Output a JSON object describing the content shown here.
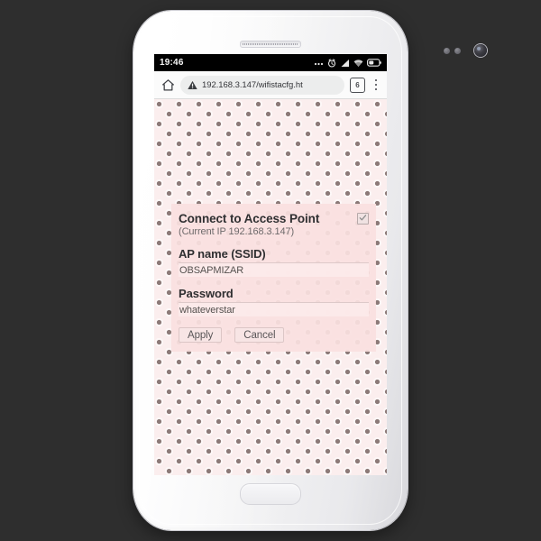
{
  "device": {
    "name": "white-smartphone",
    "earpiece": "speaker-grille",
    "home_button": "home-button"
  },
  "status_bar": {
    "clock": "19:46",
    "icons": [
      "more-dots-icon",
      "alarm-icon",
      "signal-bars-icon",
      "wifi-icon",
      "battery-icon"
    ]
  },
  "browser": {
    "home_icon": "home-icon",
    "security_icon": "warning-triangle-icon",
    "url": "192.168.3.147/wifistacfg.ht",
    "tab_count": "6",
    "menu_icon": "overflow-menu-icon"
  },
  "page": {
    "background": "pink-flower-wallpaper",
    "colors": {
      "wallpaper_base": "#fbeeee",
      "petal_light": "#f6d2d4",
      "petal_dark": "#e59aa0",
      "flower_center": "#8c7a78",
      "panel_bg": "#fae0e0",
      "input_bg": "#fceaea",
      "text_primary": "#2f2f31",
      "text_secondary": "#6e6a6b"
    }
  },
  "config_panel": {
    "title": "Connect to Access Point",
    "enable_checkbox": {
      "label": "connect-enabled",
      "checked": true
    },
    "subtitle": "(Current IP 192.168.3.147)",
    "fields": [
      {
        "label": "AP name (SSID)",
        "value": "OBSAPMIZAR",
        "placeholder": ""
      },
      {
        "label": "Password",
        "value": "whateverstar",
        "placeholder": ""
      }
    ],
    "buttons": {
      "apply": "Apply",
      "cancel": "Cancel"
    }
  }
}
